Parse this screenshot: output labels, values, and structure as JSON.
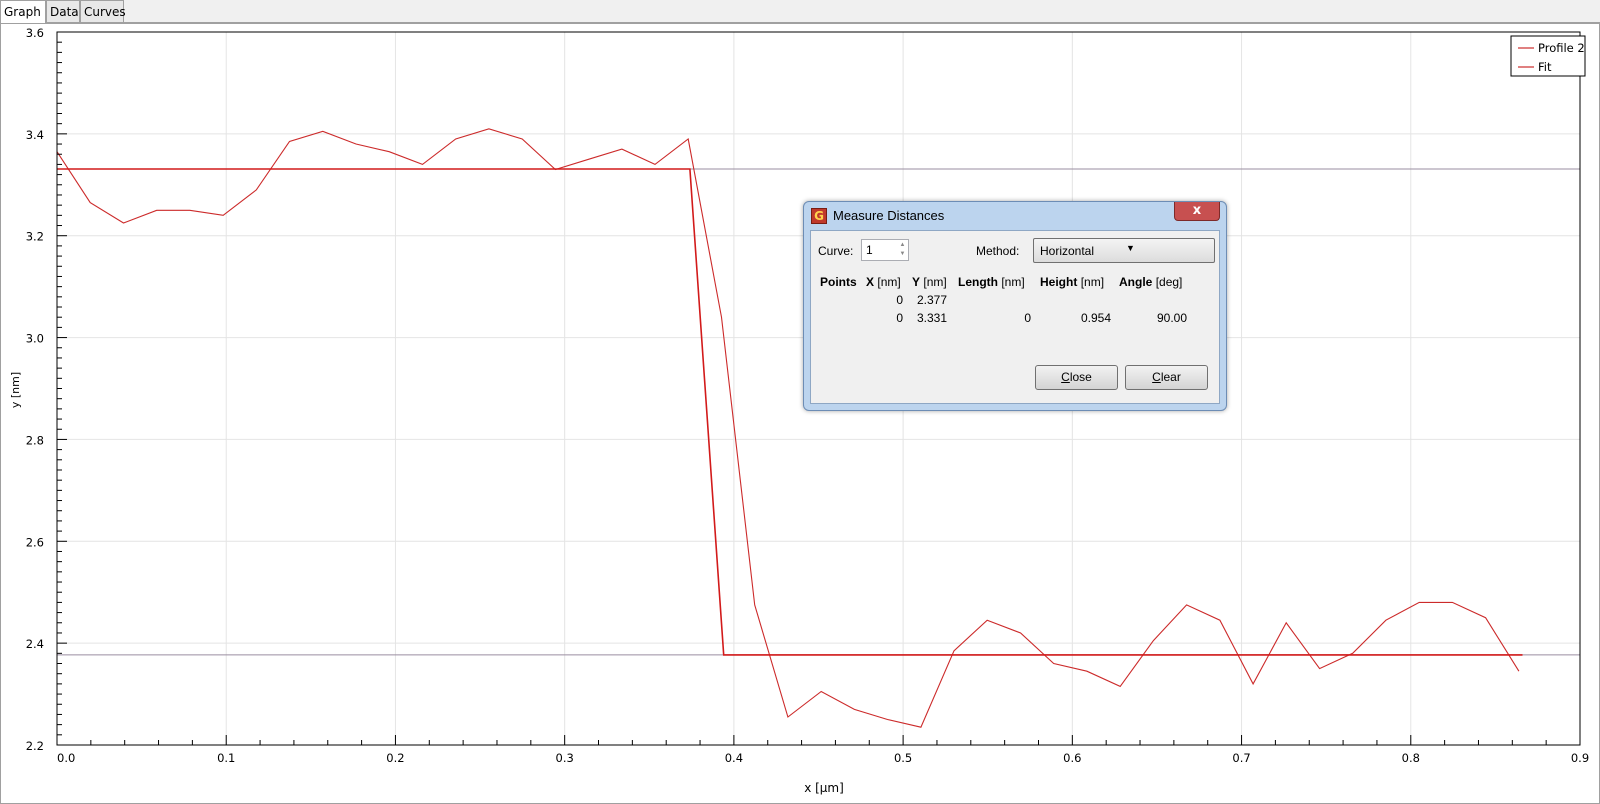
{
  "tabs": [
    {
      "label": "Graph",
      "active": true
    },
    {
      "label": "Data",
      "active": false
    },
    {
      "label": "Curves",
      "active": false
    }
  ],
  "chart_data": {
    "type": "line",
    "xlabel": "x [µm]",
    "ylabel": "y [nm]",
    "xlim": [
      0.0,
      0.9
    ],
    "ylim": [
      2.2,
      3.6
    ],
    "x_ticks": [
      0.0,
      0.1,
      0.2,
      0.3,
      0.4,
      0.5,
      0.6,
      0.7,
      0.8,
      0.9
    ],
    "x_tick_labels": [
      "0.0",
      "0.1",
      "0.2",
      "0.3",
      "0.4",
      "0.5",
      "0.6",
      "0.7",
      "0.8",
      "0.9"
    ],
    "y_ticks": [
      2.2,
      2.4,
      2.6,
      2.8,
      3.0,
      3.2,
      3.4,
      3.6
    ],
    "y_tick_labels": [
      "2.2",
      "2.4",
      "2.6",
      "2.8",
      "3.0",
      "3.2",
      "3.4",
      "3.6"
    ],
    "grid": true,
    "legend_position": "top-right",
    "series": [
      {
        "name": "Profile 2",
        "color": "#cc2a2a",
        "x": [
          0.0,
          0.0196,
          0.0393,
          0.0589,
          0.0785,
          0.0982,
          0.1178,
          0.1374,
          0.1571,
          0.1767,
          0.1963,
          0.216,
          0.2356,
          0.2552,
          0.2749,
          0.2945,
          0.3141,
          0.3338,
          0.3534,
          0.373,
          0.3927,
          0.4123,
          0.4319,
          0.4516,
          0.4712,
          0.4908,
          0.5105,
          0.5301,
          0.5497,
          0.5694,
          0.589,
          0.6086,
          0.6283,
          0.6479,
          0.6675,
          0.6872,
          0.7068,
          0.7264,
          0.7461,
          0.7657,
          0.7853,
          0.805,
          0.8246,
          0.8442,
          0.8639
        ],
        "y": [
          3.365,
          3.265,
          3.225,
          3.25,
          3.25,
          3.24,
          3.29,
          3.385,
          3.405,
          3.38,
          3.365,
          3.34,
          3.39,
          3.41,
          3.39,
          3.33,
          3.35,
          3.37,
          3.34,
          3.39,
          3.04,
          2.475,
          2.255,
          2.305,
          2.27,
          2.25,
          2.235,
          2.385,
          2.445,
          2.42,
          2.36,
          2.345,
          2.315,
          2.405,
          2.475,
          2.445,
          2.32,
          2.44,
          2.35,
          2.38,
          2.445,
          2.48,
          2.48,
          2.45,
          2.345
        ]
      },
      {
        "name": "Fit",
        "color": "#d21a1a",
        "x": [
          0.0,
          0.374,
          0.394,
          0.866
        ],
        "y": [
          3.331,
          3.331,
          2.377,
          2.377
        ]
      }
    ],
    "reference_lines_y": [
      3.331,
      2.377
    ]
  },
  "dialog": {
    "title": "Measure Distances",
    "close_glyph": "x",
    "curve_label": "Curve:",
    "curve_value": "1",
    "method_label": "Method:",
    "method_value": "Horizontal",
    "headers": [
      {
        "bold": "Points",
        "unit": ""
      },
      {
        "bold": "X",
        "unit": "[nm]"
      },
      {
        "bold": "Y",
        "unit": "[nm]"
      },
      {
        "bold": "Length",
        "unit": "[nm]"
      },
      {
        "bold": "Height",
        "unit": "[nm]"
      },
      {
        "bold": "Angle",
        "unit": "[deg]"
      }
    ],
    "rows": [
      {
        "points": "",
        "x": "0",
        "y": "2.377",
        "length": "",
        "height": "",
        "angle": ""
      },
      {
        "points": "",
        "x": "0",
        "y": "3.331",
        "length": "0",
        "height": "0.954",
        "angle": "90.00"
      }
    ],
    "close_button": {
      "mnemonic": "C",
      "rest": "lose"
    },
    "clear_button": {
      "mnemonic": "C",
      "rest": "lear"
    }
  }
}
